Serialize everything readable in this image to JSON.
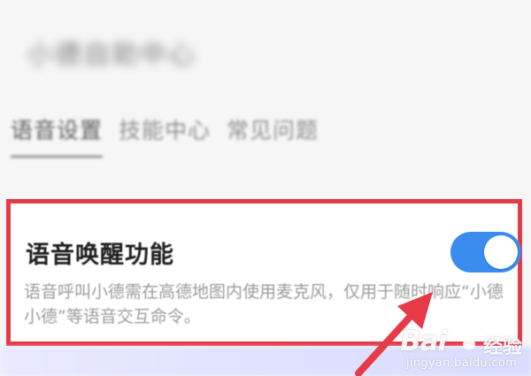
{
  "header": {
    "title": "小德自助中心"
  },
  "tabs": [
    {
      "label": "语音设置",
      "active": true
    },
    {
      "label": "技能中心",
      "active": false
    },
    {
      "label": "常见问题",
      "active": false
    }
  ],
  "setting": {
    "title": "语音唤醒功能",
    "description": "语音呼叫小德需在高德地图内使用麦克风，仅用于随时响应“小德小德”等语音交互命令。",
    "toggle_on": true
  },
  "watermark": {
    "brand": "Bai",
    "brand_suffix": "经验",
    "url": "jingyan.baidu.com"
  },
  "colors": {
    "highlight": "#e63a46",
    "toggle": "#3a8dee",
    "arrow": "#e63a46",
    "background": "#f6f6f7"
  },
  "icons": {
    "annotation_arrow": "arrow-up-right-icon",
    "watermark_logo": "baidu-paw-icon"
  }
}
